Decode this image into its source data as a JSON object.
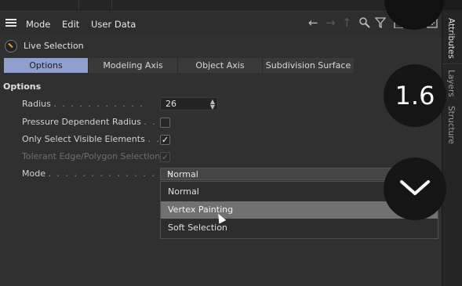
{
  "menubar": {
    "items": [
      "Mode",
      "Edit",
      "User Data"
    ],
    "tools": [
      "arrow-left-icon",
      "arrow-right-icon",
      "arrow-up-icon",
      "search-icon",
      "filter-icon",
      "lock-icon",
      "target-icon",
      "new-panel-icon"
    ]
  },
  "header": {
    "title": "Live Selection"
  },
  "tabs": [
    "Options",
    "Modeling Axis",
    "Object Axis",
    "Subdivision Surface"
  ],
  "section": {
    "title": "Options"
  },
  "fields": {
    "radius": {
      "label": "Radius",
      "dots": ". . . . . . . . . . .",
      "value": "26"
    },
    "pressure": {
      "label": "Pressure Dependent Radius",
      "dots": ". .",
      "checked": false
    },
    "visible_only": {
      "label": "Only Select Visible Elements",
      "dots": ". .",
      "checked": true
    },
    "tolerant": {
      "label": "Tolerant Edge/Polygon Selection",
      "checked": true,
      "disabled": true
    },
    "mode": {
      "label": "Mode",
      "dots": ". . . . . . . . . . . . . .",
      "value": "Normal"
    }
  },
  "dropdown": {
    "options": [
      "Normal",
      "Vertex Painting",
      "Soft Selection"
    ],
    "hovered": "Vertex Painting"
  },
  "sidebar": {
    "tabs": [
      "Attributes",
      "Layers",
      "Structure"
    ]
  },
  "overlay": {
    "zoom_label": "1.6"
  },
  "colors": {
    "accent": "#8fa0cc",
    "background": "#303030",
    "hover": "#717171"
  }
}
